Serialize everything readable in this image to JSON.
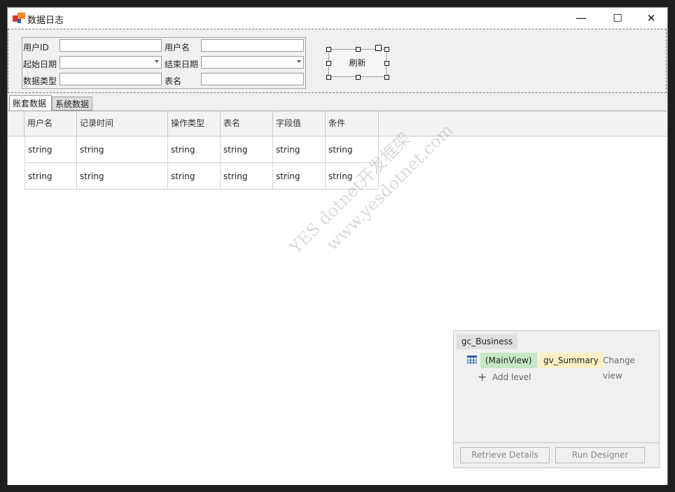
{
  "window": {
    "title": "数据日志",
    "minimize": "—",
    "maximize": "☐",
    "close": "✕"
  },
  "filter": {
    "user_id_label": "用户ID",
    "user_name_label": "用户名",
    "start_date_label": "起始日期",
    "end_date_label": "结束日期",
    "data_type_label": "数据类型",
    "table_name_label": "表名",
    "user_id_value": "",
    "user_name_value": "",
    "start_date_value": "",
    "end_date_value": "",
    "data_type_value": "",
    "table_name_value": ""
  },
  "refresh_label": "刷新",
  "tabs": [
    {
      "label": "账套数据",
      "active": true
    },
    {
      "label": "系统数据",
      "active": false
    }
  ],
  "grid": {
    "columns": [
      "用户名",
      "记录时间",
      "操作类型",
      "表名",
      "字段值",
      "条件"
    ],
    "rows": [
      [
        "string",
        "string",
        "string",
        "string",
        "string",
        "string"
      ],
      [
        "string",
        "string",
        "string",
        "string",
        "string",
        "string"
      ]
    ]
  },
  "watermark": {
    "line1": "YES dotnet开发框架",
    "line2": "www.yesdotnet.com"
  },
  "level_designer": {
    "grid_name": "gc_Business",
    "main_view": "(MainView)",
    "view_name": "gv_Summary",
    "change_view": "Change view",
    "add_level": "Add level",
    "retrieve_details": "Retrieve Details",
    "run_designer": "Run Designer"
  },
  "colors": {
    "main_view_bg": "#c6e7c6",
    "view_name_bg": "#fdf0c4",
    "icon_orange": "#f28b30",
    "icon_red": "#d9332b",
    "icon_blue": "#2a5fa8"
  }
}
